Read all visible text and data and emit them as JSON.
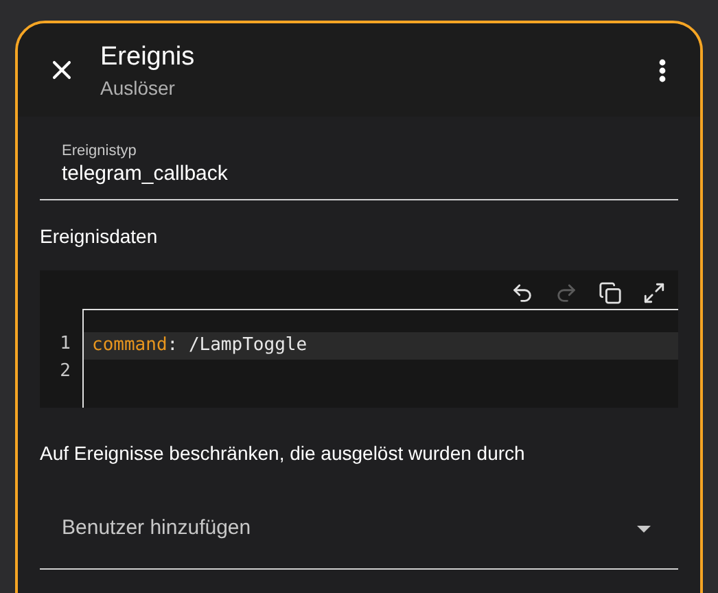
{
  "dialog": {
    "title": "Ereignis",
    "subtitle": "Auslöser"
  },
  "event_type": {
    "label": "Ereignistyp",
    "value": "telegram_callback"
  },
  "event_data": {
    "label": "Ereignisdaten",
    "toolbar": [
      {
        "kind": "undo",
        "disabled": false
      },
      {
        "kind": "redo",
        "disabled": true
      },
      {
        "kind": "copy",
        "disabled": false
      },
      {
        "kind": "expand",
        "disabled": false
      }
    ],
    "lines": [
      {
        "number": "1",
        "key": "command",
        "rest": ": /LampToggle",
        "active": true
      },
      {
        "number": "2",
        "active": false
      }
    ]
  },
  "restrict": {
    "label": "Auf Ereignisse beschränken, die ausgelöst wurden durch",
    "placeholder": "Benutzer hinzufügen"
  }
}
